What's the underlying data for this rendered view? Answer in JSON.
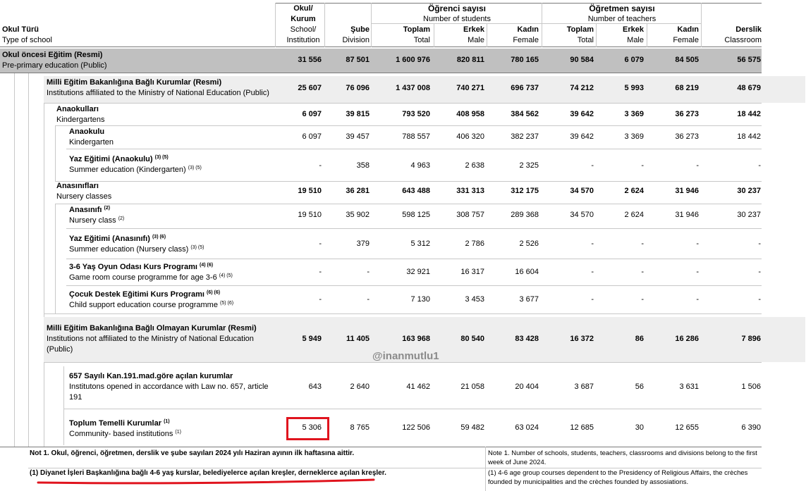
{
  "header": {
    "school_type_tr": "Okul Türü",
    "school_type_en": "Type of school",
    "institution_tr1": "Okul/",
    "institution_tr2": "Kurum",
    "institution_tr3": "School/",
    "institution_en": "Institution",
    "division_tr": "Şube",
    "division_en": "Division",
    "students_group_tr": "Öğrenci sayısı",
    "students_group_en": "Number of students",
    "teachers_group_tr": "Öğretmen sayısı",
    "teachers_group_en": "Number of  teachers",
    "total_tr": "Toplam",
    "total_en": "Total",
    "male_tr": "Erkek",
    "male_en": "Male",
    "female_tr": "Kadın",
    "female_en": "Female",
    "classroom_tr": "Derslik",
    "classroom_en": "Classroom"
  },
  "rows": [
    {
      "tr": "Okul öncesi Eğitim (Resmi)",
      "en": "Pre-primary education (Public)",
      "sup_tr": "",
      "sup_en": "",
      "values": [
        "31 556",
        "87 501",
        "1 600 976",
        "820 811",
        "780 165",
        "90 584",
        "6 079",
        "84 505",
        "56 575"
      ]
    },
    {
      "tr": "Milli Eğitim Bakanlığına Bağlı Kurumlar (Resmi)",
      "en": "Institutions affiliated to the Ministry of National Education (Public)",
      "sup_tr": "",
      "sup_en": "",
      "values": [
        "25 607",
        "76 096",
        "1 437 008",
        "740 271",
        "696 737",
        "74 212",
        "5 993",
        "68 219",
        "48 679"
      ]
    },
    {
      "tr": "Anaokulları",
      "en": "Kindergartens",
      "sup_tr": "",
      "sup_en": "",
      "values": [
        "6 097",
        "39 815",
        "793 520",
        "408 958",
        "384 562",
        "39 642",
        "3 369",
        "36 273",
        "18 442"
      ]
    },
    {
      "tr": "Anaokulu",
      "en": "Kindergarten",
      "sup_tr": "",
      "sup_en": "",
      "values": [
        "6 097",
        "39 457",
        "788 557",
        "406 320",
        "382 237",
        "39 642",
        "3 369",
        "36 273",
        "18 442"
      ]
    },
    {
      "tr": "Yaz Eğitimi    (Anaokulu)",
      "en": "Summer education  (Kindergarten)",
      "sup_tr": "(3) (5)",
      "sup_en": "(3) (5)",
      "values": [
        "-",
        "358",
        "4 963",
        "2 638",
        "2 325",
        "-",
        "-",
        "-",
        "-"
      ]
    },
    {
      "tr": "Anasınıfları",
      "en": "Nursery classes",
      "sup_tr": "",
      "sup_en": "",
      "values": [
        "19 510",
        "36 281",
        "643 488",
        "331 313",
        "312 175",
        "34 570",
        "2 624",
        "31 946",
        "30 237"
      ]
    },
    {
      "tr": "Anasınıfı",
      "en": "Nursery class",
      "sup_tr": "(2)",
      "sup_en": "(2)",
      "values": [
        "19 510",
        "35 902",
        "598 125",
        "308 757",
        "289 368",
        "34 570",
        "2 624",
        "31 946",
        "30 237"
      ]
    },
    {
      "tr": "Yaz Eğitimi (Anasınıfı)",
      "en": "Summer education (Nursery class)",
      "sup_tr": "(3) (6)",
      "sup_en": "(3) (5)",
      "values": [
        "-",
        "379",
        "5 312",
        "2 786",
        "2 526",
        "-",
        "-",
        "-",
        "-"
      ]
    },
    {
      "tr": "3-6 Yaş Oyun Odası Kurs Programı",
      "en": "Game room course programme for age 3-6",
      "sup_tr": "(4) (6)",
      "sup_en": "(4) (5)",
      "values": [
        "-",
        "-",
        "32 921",
        "16 317",
        "16 604",
        "-",
        "-",
        "-",
        "-"
      ]
    },
    {
      "tr": "Çocuk Destek Eğitimi Kurs Programı",
      "en": "Child support education course programme",
      "sup_tr": "(6) (6)",
      "sup_en": "(5) (6)",
      "values": [
        "-",
        "-",
        "7 130",
        "3 453",
        "3 677",
        "-",
        "-",
        "-",
        "-"
      ]
    },
    {
      "tr": "Milli Eğitim Bakanlığına Bağlı Olmayan Kurumlar (Resmi)",
      "en": "Institutions not affiliated to the Ministry of National Education",
      "en2": "(Public)",
      "sup_tr": "",
      "sup_en": "",
      "values": [
        "5 949",
        "11 405",
        "163 968",
        "80 540",
        "83 428",
        "16 372",
        "86",
        "16 286",
        "7 896"
      ]
    },
    {
      "tr": "657 Sayılı Kan.191.mad.göre açılan kurumlar",
      "en": "Institutons opened in accordance with Law no. 657,  article",
      "en2": "191",
      "sup_tr": "",
      "sup_en": "",
      "values": [
        "643",
        "2 640",
        "41 462",
        "21 058",
        "20 404",
        "3 687",
        "56",
        "3 631",
        "1 506"
      ]
    },
    {
      "tr": "Toplum Temelli Kurumlar",
      "en": "Community- based institutions",
      "sup_tr": "(1)",
      "sup_en": "(1)",
      "values": [
        "5 306",
        "8 765",
        "122 506",
        "59 482",
        "63 024",
        "12 685",
        "30",
        "12 655",
        "6 390"
      ]
    }
  ],
  "notes": {
    "note_tr": "Not 1. Okul, öğrenci, öğretmen, derslik ve şube sayıları 2024 yılı Haziran ayının ilk haftasına aittir.",
    "note_en_1": "Note 1. Number of schools, students, teachers, classrooms and divisions belong to the first",
    "note_en_2": "week of June 2024.",
    "fn1_tr": "(1) Diyanet İşleri Başkanlığına bağlı 4-6 yaş kurslar, belediyelerce açılan kreşler, derneklerce açılan kreşler.",
    "fn1_en_1": "(1) 4-6 age group courses dependent to the Presidency of Religious Affairs, the crèches",
    "fn1_en_2": "founded by municipalities and  the crèches founded by assosiations."
  },
  "watermark": "@inanmutlu1",
  "colors": {
    "gray_band": "#c0c0c0",
    "light_band": "#eeeeee",
    "highlight_red": "#e0141e"
  }
}
